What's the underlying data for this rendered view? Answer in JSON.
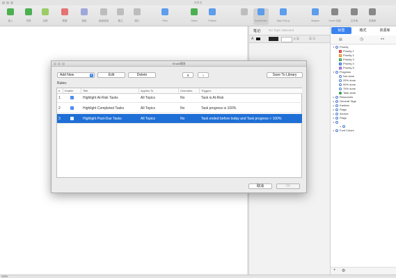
{
  "window": {
    "title": "未命名"
  },
  "toolbar": {
    "buttons": [
      {
        "label": "插入",
        "icon": "insert-topic-icon",
        "color": "#4caf50"
      },
      {
        "label": "关联",
        "icon": "relationship-icon",
        "color": "#4caf50"
      },
      {
        "label": "边框",
        "icon": "boundary-icon",
        "color": "#9ccc65"
      },
      {
        "label": "概要",
        "icon": "summary-icon",
        "color": "#e57373"
      },
      {
        "label": "链接",
        "icon": "link-icon",
        "color": "#9fa8da"
      },
      {
        "label": "超级链接",
        "icon": "hyperlink-icon",
        "color": "#bdbdbd"
      },
      {
        "label": "备注",
        "icon": "notes-icon",
        "color": "#bdbdbd"
      },
      {
        "label": "图片",
        "icon": "image-icon",
        "color": "#bdbdbd"
      },
      {
        "label": "Filter",
        "icon": "filter-icon",
        "color": "#5c9ded"
      },
      {
        "label": "Share",
        "icon": "share-icon",
        "color": "#4caf50"
      },
      {
        "label": "Publish",
        "icon": "publish-icon",
        "color": "#5c9ded"
      },
      {
        "label": "",
        "icon": "layout-icon",
        "color": "#bdbdbd"
      },
      {
        "label": "SmartRules",
        "icon": "smartrules-icon",
        "color": "#5c9ded"
      },
      {
        "label": "Map Roll-up",
        "icon": "map-rollup-icon",
        "color": "#5c9ded"
      },
      {
        "label": "Shapes",
        "icon": "shapes-icon",
        "color": "#5c9ded"
      },
      {
        "label": "Smart 页面",
        "icon": "smart-page-icon",
        "color": "#888888"
      },
      {
        "label": "文本库",
        "icon": "text-library-icon",
        "color": "#888888"
      },
      {
        "label": "资源库",
        "icon": "resource-library-icon",
        "color": "#888888"
      }
    ]
  },
  "inspector": {
    "notes_label": "笔记:",
    "notes_placeholder": "No Topic Selected"
  },
  "right_panel": {
    "tabs": [
      "标签",
      "格式",
      "资源库"
    ],
    "tree": [
      {
        "label": "Priority",
        "level": 0,
        "expanded": true,
        "kind": "group"
      },
      {
        "label": "Priority 1",
        "level": 1,
        "kind": "priority",
        "badge": "1",
        "color": "#d9302c"
      },
      {
        "label": "Priority 2",
        "level": 1,
        "kind": "priority",
        "badge": "2",
        "color": "#e78a1e"
      },
      {
        "label": "Priority 3",
        "level": 1,
        "kind": "priority",
        "badge": "3",
        "color": "#2f9e44"
      },
      {
        "label": "Priority 4",
        "level": 1,
        "kind": "priority",
        "badge": "4",
        "color": "#3b78d8"
      },
      {
        "label": "Priority 5",
        "level": 1,
        "kind": "priority",
        "badge": "5",
        "color": "#8e5bd0"
      },
      {
        "label": "Progress",
        "level": 0,
        "expanded": true,
        "kind": "group"
      },
      {
        "label": "Not done",
        "level": 1,
        "kind": "progress"
      },
      {
        "label": "25% done",
        "level": 1,
        "kind": "progress"
      },
      {
        "label": "50% done",
        "level": 1,
        "kind": "progress"
      },
      {
        "label": "75% done",
        "level": 1,
        "kind": "progress"
      },
      {
        "label": "Task done",
        "level": 1,
        "kind": "done"
      },
      {
        "label": "Resources",
        "level": 0,
        "expanded": false,
        "kind": "group"
      },
      {
        "label": "General Tags",
        "level": 0,
        "expanded": false,
        "kind": "group"
      },
      {
        "label": "Kanban",
        "level": 0,
        "expanded": false,
        "kind": "group"
      },
      {
        "label": "Flags",
        "level": 0,
        "expanded": false,
        "kind": "group"
      },
      {
        "label": "Arrows",
        "level": 0,
        "expanded": false,
        "kind": "group"
      },
      {
        "label": "Flags",
        "level": 0,
        "expanded": false,
        "kind": "group"
      },
      {
        "label": "",
        "level": 0,
        "expanded": false,
        "kind": "group"
      },
      {
        "label": "",
        "level": 1,
        "expanded": false,
        "kind": "group"
      },
      {
        "label": "Font Colors",
        "level": 0,
        "expanded": false,
        "kind": "group"
      }
    ],
    "footer_add": "+",
    "footer_settings": "⚙"
  },
  "statusbar": {
    "zoom": "100%"
  },
  "dialog": {
    "title": "Smart规则",
    "add_new_label": "Add New",
    "edit_label": "Edit",
    "delete_label": "Delete",
    "move_up_label": "⬆",
    "move_down_label": "⬇",
    "save_library_label": "Save To Library",
    "rules_label": "Rules:",
    "columns": [
      "#",
      "Enable",
      "Title",
      "Applies To",
      "Overrides",
      "Triggers"
    ],
    "rows": [
      {
        "num": "1",
        "enabled": true,
        "title": "Highlight At-Risk Tasks",
        "applies": "All Topics",
        "overrides": "No",
        "triggers": "Task is At-Risk",
        "selected": false
      },
      {
        "num": "2",
        "enabled": true,
        "title": "Highlight Completed Tasks",
        "applies": "All Topics",
        "overrides": "No",
        "triggers": "Task progress is 100%",
        "selected": false
      },
      {
        "num": "3",
        "enabled": true,
        "title": "Highlight Past-Due Tasks",
        "applies": "All Topics",
        "overrides": "No",
        "triggers": "Task ended before today and Task progress < 100%",
        "selected": true
      }
    ],
    "cancel_label": "取消",
    "ok_label": "OK"
  }
}
